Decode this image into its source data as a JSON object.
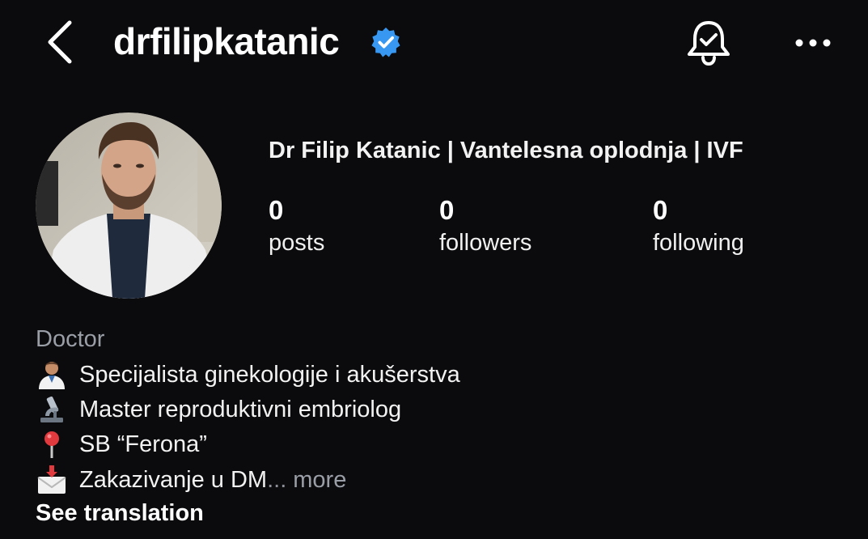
{
  "header": {
    "username": "drfilipkatanic",
    "verified_color": "#3897f0"
  },
  "profile": {
    "full_name": "Dr Filip Katanic | Vantelesna oplodnja | IVF",
    "stats": [
      {
        "value": "0",
        "label": "posts"
      },
      {
        "value": "0",
        "label": "followers"
      },
      {
        "value": "0",
        "label": "following"
      }
    ]
  },
  "bio": {
    "category": "Doctor",
    "lines": [
      {
        "icon": "doctor-emoji-icon",
        "text": "Specijalista ginekologije i akušerstva"
      },
      {
        "icon": "microscope-emoji-icon",
        "text": "Master reproduktivni embriolog"
      },
      {
        "icon": "pin-emoji-icon",
        "text": "SB “Ferona”"
      },
      {
        "icon": "envelope-emoji-icon",
        "text": "Zakazivanje u DM"
      }
    ],
    "ellipsis": "...",
    "more_label": "more",
    "see_translation": "See translation"
  }
}
